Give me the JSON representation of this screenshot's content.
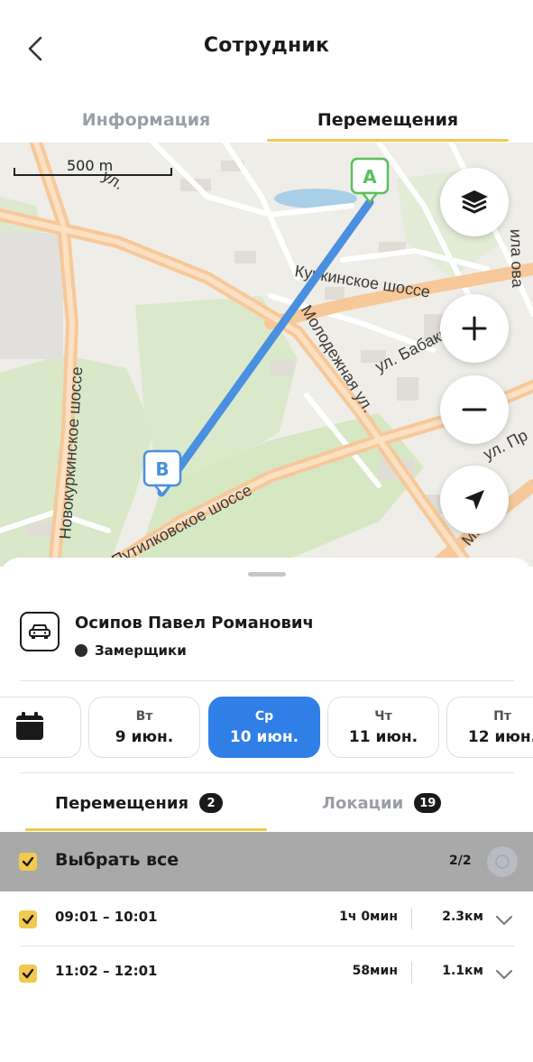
{
  "header": {
    "title": "Сотрудник",
    "back_icon": "chevron-left-icon"
  },
  "top_tabs": [
    {
      "label": "Информация",
      "active": false
    },
    {
      "label": "Перемещения",
      "active": true
    }
  ],
  "map": {
    "scale_label": "500 m",
    "street_labels": [
      "Новокуркинское шоссе",
      "Куркинское шоссе",
      "Молодежная ул.",
      "ул. Бабакина",
      "Путилковское шоссе",
      "ул. Пр",
      "МКАД",
      "ул.",
      "ила ова"
    ],
    "marker_a": "A",
    "marker_b": "B",
    "route_color": "#4a8fe0",
    "controls": [
      "layers-icon",
      "zoom-in-icon",
      "zoom-out-icon",
      "locate-icon"
    ]
  },
  "employee": {
    "name": "Осипов Павел Романович",
    "group": "Замерщики",
    "icon": "car-icon"
  },
  "days": [
    {
      "weekday": "Вт",
      "date": "9 июн.",
      "active": false
    },
    {
      "weekday": "Ср",
      "date": "10 июн.",
      "active": true
    },
    {
      "weekday": "Чт",
      "date": "11 июн.",
      "active": false
    },
    {
      "weekday": "Пт",
      "date": "12 июн.",
      "active": false
    }
  ],
  "sub_tabs": [
    {
      "label": "Перемещения",
      "count": "2",
      "active": true
    },
    {
      "label": "Локации",
      "count": "19",
      "active": false
    }
  ],
  "select_all": {
    "label": "Выбрать все",
    "count": "2/2",
    "checked": true
  },
  "trips": [
    {
      "time": "09:01 – 10:01",
      "duration": "1ч 0мин",
      "distance": "2.3км",
      "checked": true
    },
    {
      "time": "11:02 – 12:01",
      "duration": "58мин",
      "distance": "1.1км",
      "checked": true
    }
  ],
  "colors": {
    "accent": "#f2c94c",
    "active_day": "#2f7fe6",
    "marker_a": "#5cbf5c",
    "marker_b": "#4a8fe0"
  }
}
